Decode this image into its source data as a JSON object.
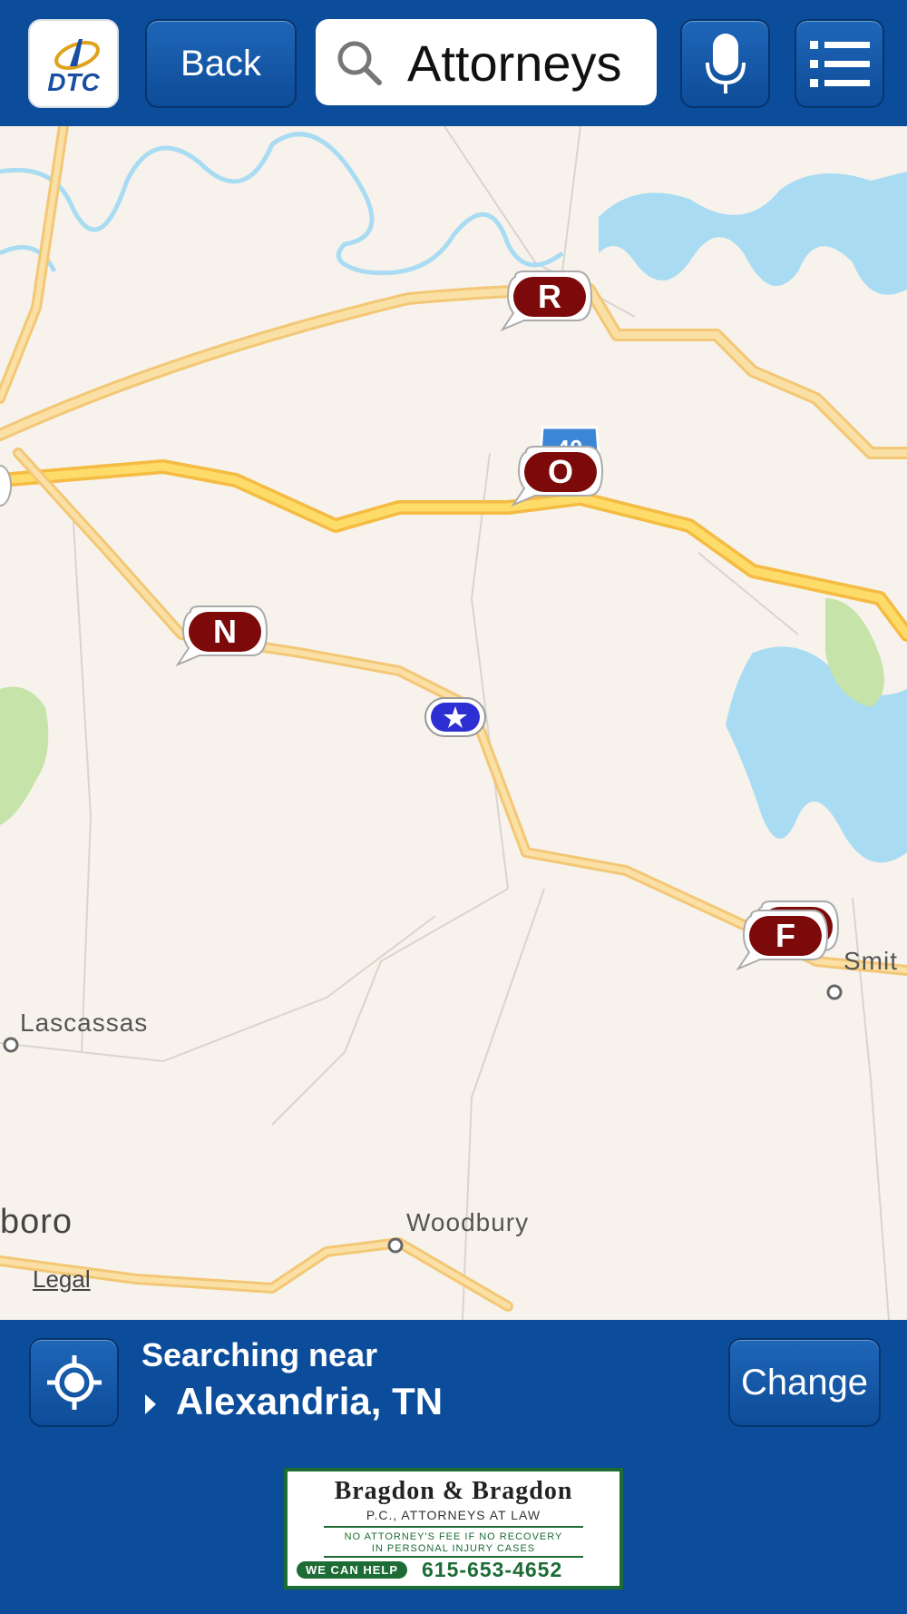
{
  "header": {
    "logo_text": "DTC",
    "back_label": "Back",
    "search_value": "Attorneys"
  },
  "map": {
    "pins": [
      {
        "letter": "R"
      },
      {
        "letter": "O"
      },
      {
        "letter": "N"
      },
      {
        "letter": "F"
      }
    ],
    "interstate_shield": "40",
    "towns": {
      "lascassas": "Lascassas",
      "woodbury": "Woodbury",
      "smith": "Smit",
      "boro": "boro"
    },
    "legal": "Legal",
    "colors": {
      "pin": "#7d0a0a",
      "current_location": "#2d2fd3",
      "water": "#a9dcf3",
      "park": "#c6e3a9",
      "road": "#f7c56a"
    }
  },
  "footer": {
    "searching_label": "Searching near",
    "location": "Alexandria, TN",
    "change_label": "Change"
  },
  "ad": {
    "title": "Bragdon & Bragdon",
    "subtitle": "P.C., ATTORNEYS AT LAW",
    "line1": "NO ATTORNEY'S FEE IF NO RECOVERY",
    "line2": "IN PERSONAL INJURY CASES",
    "tagline": "WE CAN HELP",
    "phone": "615-653-4652"
  }
}
